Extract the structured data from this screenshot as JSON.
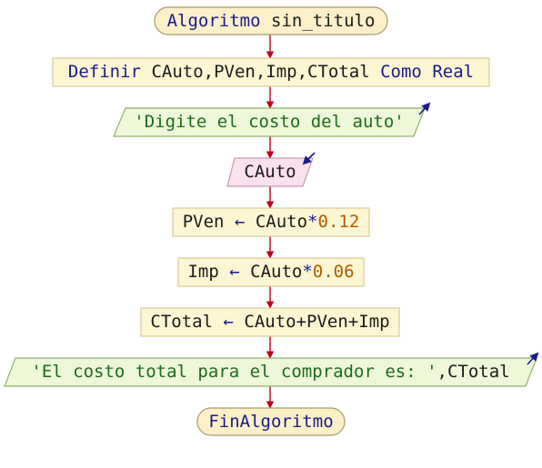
{
  "flow": {
    "start": {
      "keyword": "Algoritmo",
      "name": "sin_titulo"
    },
    "define": {
      "keyword": "Definir",
      "vars": "CAuto,PVen,Imp,CTotal",
      "as_kw": "Como",
      "type_kw": "Real"
    },
    "output1": {
      "text": "'Digite el costo del auto'"
    },
    "input1": {
      "var": "CAuto"
    },
    "assign1": {
      "target": "PVen",
      "arrow": "←",
      "expr": "CAuto",
      "op": "*",
      "num": "0.12"
    },
    "assign2": {
      "target": "Imp",
      "arrow": "←",
      "expr": "CAuto",
      "op": "*",
      "num": "0.06"
    },
    "assign3": {
      "target": "CTotal",
      "arrow": "←",
      "expr": "CAuto+PVen+Imp"
    },
    "output2": {
      "text": "'El costo total para el comprador es: '",
      "suffix": ",CTotal"
    },
    "end": {
      "keyword": "FinAlgoritmo"
    }
  },
  "colors": {
    "terminal_fill": "#fbf0c8",
    "process_fill": "#fdf6d2",
    "output_fill": "#eef8d8",
    "input_fill": "#fbe0ee",
    "connector": "#c0001a",
    "border": "#a89a6a"
  },
  "icons": {
    "output_marker": "arrow-up-right-icon",
    "input_marker": "arrow-down-left-icon"
  }
}
